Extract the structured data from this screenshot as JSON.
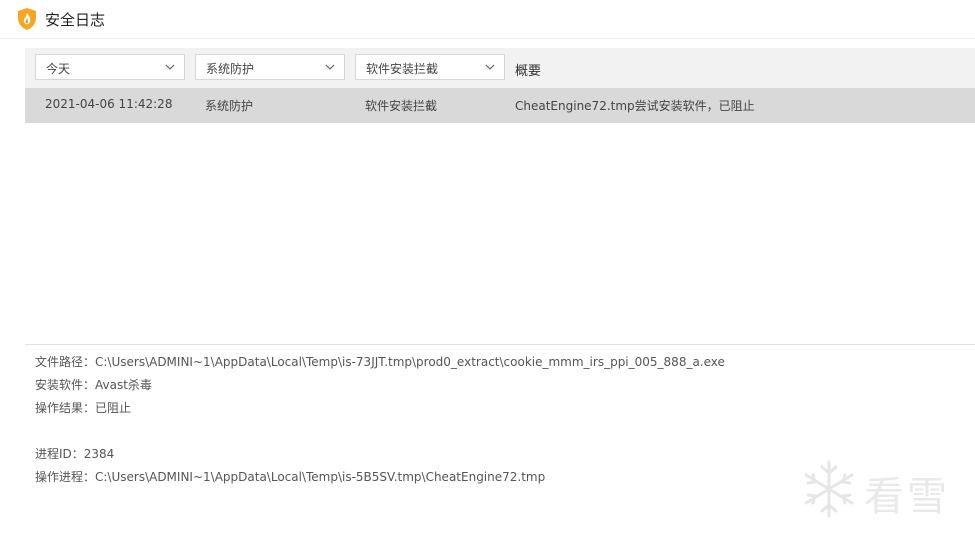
{
  "window": {
    "title": "安全日志",
    "icon": "shield-flame-icon"
  },
  "filters": {
    "date": {
      "selected": "今天"
    },
    "category": {
      "selected": "系统防护"
    },
    "type": {
      "selected": "软件安装拦截"
    },
    "summary_header": "概要"
  },
  "log_rows": [
    {
      "time": "2021-04-06 11:42:28",
      "category": "系统防护",
      "type": "软件安装拦截",
      "summary": "CheatEngine72.tmp尝试安装软件，已阻止"
    }
  ],
  "details": {
    "file_path": "文件路径：C:\\Users\\ADMINI~1\\AppData\\Local\\Temp\\is-73JJT.tmp\\prod0_extract\\cookie_mmm_irs_ppi_005_888_a.exe",
    "software": "安装软件：Avast杀毒",
    "result": "操作结果：已阻止",
    "process_id": "进程ID：2384",
    "process": "操作进程：C:\\Users\\ADMINI~1\\AppData\\Local\\Temp\\is-5B5SV.tmp\\CheatEngine72.tmp"
  },
  "watermark": {
    "text": "看雪",
    "icon": "snowflake-icon"
  },
  "colors": {
    "accent_orange": "#f5a623",
    "row_selected": "#d9d9d9",
    "toolbar_bg": "#f2f2f2"
  }
}
